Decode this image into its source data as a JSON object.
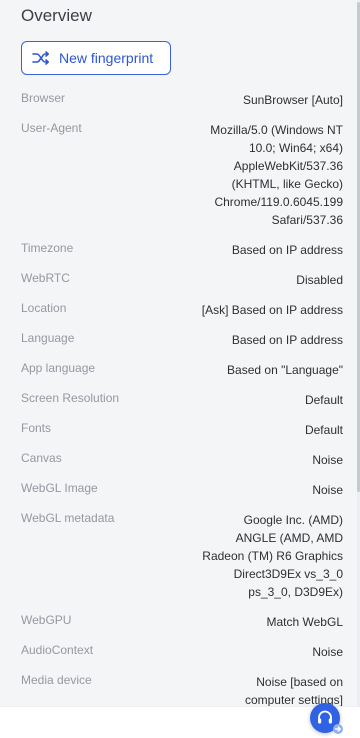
{
  "section_title": "Overview",
  "new_fingerprint_label": "New fingerprint",
  "accent_color": "#2f55cf",
  "rows": [
    {
      "label": "Browser",
      "value": "SunBrowser [Auto]"
    },
    {
      "label": "User-Agent",
      "value": "Mozilla/5.0 (Windows NT\n10.0; Win64; x64)\nAppleWebKit/537.36\n(KHTML, like Gecko)\nChrome/119.0.6045.199\nSafari/537.36"
    },
    {
      "label": "Timezone",
      "value": "Based on IP address"
    },
    {
      "label": "WebRTC",
      "value": "Disabled"
    },
    {
      "label": "Location",
      "value": "[Ask] Based on IP address"
    },
    {
      "label": "Language",
      "value": "Based on IP address"
    },
    {
      "label": "App language",
      "value": "Based on \"Language\""
    },
    {
      "label": "Screen Resolution",
      "value": "Default"
    },
    {
      "label": "Fonts",
      "value": "Default"
    },
    {
      "label": "Canvas",
      "value": "Noise"
    },
    {
      "label": "WebGL Image",
      "value": "Noise"
    },
    {
      "label": "WebGL metadata",
      "value": "Google Inc. (AMD)\nANGLE (AMD, AMD\nRadeon (TM) R6 Graphics\nDirect3D9Ex vs_3_0\nps_3_0, D3D9Ex)"
    },
    {
      "label": "WebGPU",
      "value": "Match WebGL"
    },
    {
      "label": "AudioContext",
      "value": "Noise"
    },
    {
      "label": "Media device",
      "value": "Noise [based on\ncomputer settings]"
    }
  ],
  "icons": {
    "new_fingerprint": "shuffle-icon",
    "support": "headset-icon",
    "support_badge": "arrow-right-icon"
  }
}
